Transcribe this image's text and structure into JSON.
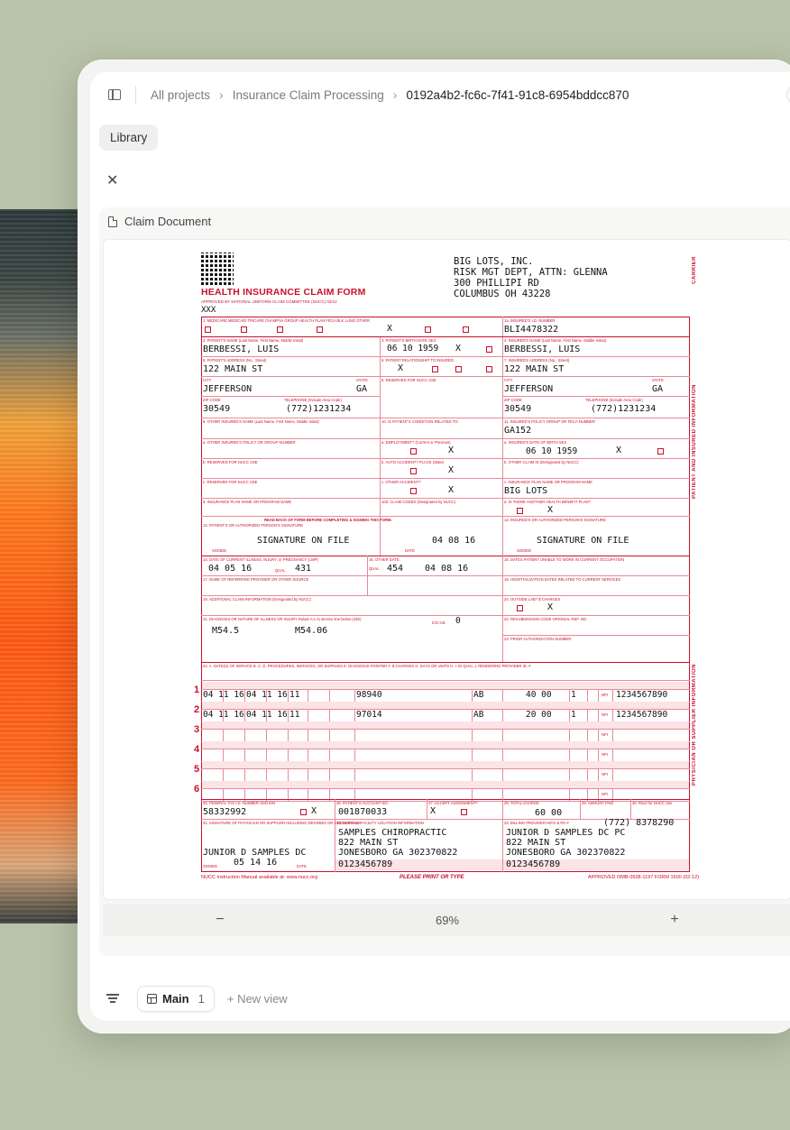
{
  "breadcrumb": {
    "items": [
      "All projects",
      "Insurance Claim Processing"
    ],
    "current": "0192a4b2-fc6c-7f41-91c8-6954bddcc870"
  },
  "library_label": "Library",
  "doc_header": "Claim Document",
  "zoom": {
    "level": "69%",
    "minus": "−",
    "plus": "+"
  },
  "bottom": {
    "tab_label": "Main",
    "tab_count": "1",
    "new_view": "+ New view"
  },
  "form": {
    "title": "HEALTH INSURANCE CLAIM FORM",
    "approved": "APPROVED BY NATIONAL UNIFORM CLAIM COMMITTEE (NUCC) 02/12",
    "pica": "XXX",
    "carrier_address": "BIG LOTS, INC.\nRISK MGT DEPT, ATTN: GLENNA\n300 PHILLIPI RD\nCOLUMBUS OH 43228",
    "side_carrier": "CARRIER",
    "side_patient": "PATIENT AND INSURED INFORMATION",
    "side_physician": "PHYSICIAN OR SUPPLIER INFORMATION",
    "labels": {
      "l1": "1. MEDICARE   MEDICAID   TRICARE   CHAMPVA   GROUP HEALTH PLAN   FECA BLK LUNG   OTHER",
      "l1a": "1a. INSURED'S I.D. NUMBER",
      "l2": "2. PATIENT'S NAME (Last Name, First Name, Middle Initial)",
      "l3": "3. PATIENT'S BIRTH DATE   SEX",
      "l4": "4. INSURED'S NAME (Last Name, First Name, Middle Initial)",
      "l5": "5. PATIENT'S ADDRESS (No., Street)",
      "l6": "6. PATIENT RELATIONSHIP TO INSURED",
      "l7": "7. INSURED'S ADDRESS (No., Street)",
      "lcity": "CITY",
      "lstate": "STATE",
      "l8": "8. RESERVED FOR NUCC USE",
      "lzip": "ZIP CODE",
      "ltel": "TELEPHONE (Include Area Code)",
      "l9": "9. OTHER INSURED'S NAME (Last Name, First Name, Middle Initial)",
      "l10": "10. IS PATIENT'S CONDITION RELATED TO:",
      "l11": "11. INSURED'S POLICY GROUP OR FECA NUMBER",
      "l9a": "a. OTHER INSURED'S POLICY OR GROUP NUMBER",
      "l10a": "a. EMPLOYMENT? (Current or Previous)",
      "l11a": "a. INSURED'S DATE OF BIRTH   SEX",
      "l9b": "b. RESERVED FOR NUCC USE",
      "l10b": "b. AUTO ACCIDENT?   PLACE (State)",
      "l11b": "b. OTHER CLAIM ID (Designated by NUCC)",
      "l9c": "c. RESERVED FOR NUCC USE",
      "l10c": "c. OTHER ACCIDENT?",
      "l11c": "c. INSURANCE PLAN NAME OR PROGRAM NAME",
      "l9d": "d. INSURANCE PLAN NAME OR PROGRAM NAME",
      "l10d": "10d. CLAIM CODES (Designated by NUCC)",
      "l11d": "d. IS THERE ANOTHER HEALTH BENEFIT PLAN?",
      "readback": "READ BACK OF FORM BEFORE COMPLETING & SIGNING THIS FORM.",
      "l12": "12. PATIENT'S OR AUTHORIZED PERSON'S SIGNATURE",
      "l13": "13. INSURED'S OR AUTHORIZED PERSON'S SIGNATURE",
      "signed": "SIGNED",
      "date": "DATE",
      "l14": "14. DATE OF CURRENT ILLNESS, INJURY, or PREGNANCY (LMP)",
      "l15": "15. OTHER DATE",
      "l16": "16. DATES PATIENT UNABLE TO WORK IN CURRENT OCCUPATION",
      "l17": "17. NAME OF REFERRING PROVIDER OR OTHER SOURCE",
      "l18": "18. HOSPITALIZATION DATES RELATED TO CURRENT SERVICES",
      "l19": "19. ADDITIONAL CLAIM INFORMATION (Designated by NUCC)",
      "l20": "20. OUTSIDE LAB?   $ CHARGES",
      "l21": "21. DIAGNOSIS OR NATURE OF ILLNESS OR INJURY  Relate A-L to service line below (24E)",
      "l22": "22. RESUBMISSION CODE   ORIGINAL REF. NO.",
      "l23": "23. PRIOR AUTHORIZATION NUMBER",
      "l24": "24. A. DATE(S) OF SERVICE   B.   C.   D. PROCEDURES, SERVICES, OR SUPPLIES   E. DIAGNOSIS POINTER   F. $ CHARGES   G. DAYS OR UNITS   H.   I. ID QUAL   J. RENDERING PROVIDER ID. #",
      "l25": "25. FEDERAL TAX I.D. NUMBER   SSN EIN",
      "l26": "26. PATIENT'S ACCOUNT NO.",
      "l27": "27. ACCEPT ASSIGNMENT?",
      "l28": "28. TOTAL CHARGE",
      "l29": "29. AMOUNT PAID",
      "l30": "30. Rsvd for NUCC Use",
      "l31": "31. SIGNATURE OF PHYSICIAN OR SUPPLIER INCLUDING DEGREES OR CREDENTIALS",
      "l32": "32. SERVICE FACILITY LOCATION INFORMATION",
      "l33": "33. BILLING PROVIDER INFO & PH #",
      "yes": "YES",
      "no": "NO",
      "npi": "NPI",
      "qual": "QUAL",
      "icdind": "ICD Ind."
    },
    "values": {
      "insured_id": "BLI4478322",
      "patient_name": "BERBESSI, LUIS",
      "birth_date": "06 10 1959",
      "insured_name": "BERBESSI, LUIS",
      "patient_address": "122 MAIN ST",
      "insured_address": "122 MAIN ST",
      "patient_city": "JEFFERSON",
      "patient_state": "GA",
      "insured_city": "JEFFERSON",
      "insured_state": "GA",
      "patient_zip": "30549",
      "patient_tel": "(772)1231234",
      "insured_zip": "30549",
      "insured_tel": "(772)1231234",
      "policy_group": "GA152",
      "insured_dob": "06 10 1959",
      "insurance_plan": "BIG LOTS",
      "sig12": "SIGNATURE ON FILE",
      "sig12_date": "04 08 16",
      "sig13": "SIGNATURE ON FILE",
      "date14": "04 05 16",
      "qual14": "431",
      "qual15": "454",
      "date15": "04 08 16",
      "icd_ind": "0",
      "diag_a": "M54.5",
      "diag_b": "M54.06",
      "tax_id": "58332992",
      "account_no": "001870033",
      "total_charge": "60 00",
      "physician_sig": "JUNIOR D SAMPLES DC",
      "physician_sig_date": "05 14 16",
      "facility": "SAMPLES CHIROPRACTIC\n822 MAIN ST\nJONESBORO GA 302370822",
      "facility_npi": "0123456789",
      "billing_phone": "(772) 8378290",
      "billing": "JUNIOR D SAMPLES DC PC\n822 MAIN ST\nJONESBORO GA 302370822",
      "billing_npi": "0123456789",
      "x": "X"
    },
    "service_lines": [
      {
        "num": "1",
        "from": "04 11 16",
        "to": "04 11 16",
        "pos": "11",
        "cpt": "98940",
        "pointer": "AB",
        "charges": "40 00",
        "units": "1",
        "provider": "1234567890"
      },
      {
        "num": "2",
        "from": "04 11 16",
        "to": "04 11 16",
        "pos": "11",
        "cpt": "97014",
        "pointer": "AB",
        "charges": "20 00",
        "units": "1",
        "provider": "1234567890"
      },
      {
        "num": "3"
      },
      {
        "num": "4"
      },
      {
        "num": "5"
      },
      {
        "num": "6"
      }
    ],
    "footer_left": "NUCC Instruction Manual available at: www.nucc.org",
    "footer_mid": "PLEASE PRINT OR TYPE",
    "footer_right": "APPROVED OMB-0938-1197 FORM 1500 (02-12)"
  }
}
